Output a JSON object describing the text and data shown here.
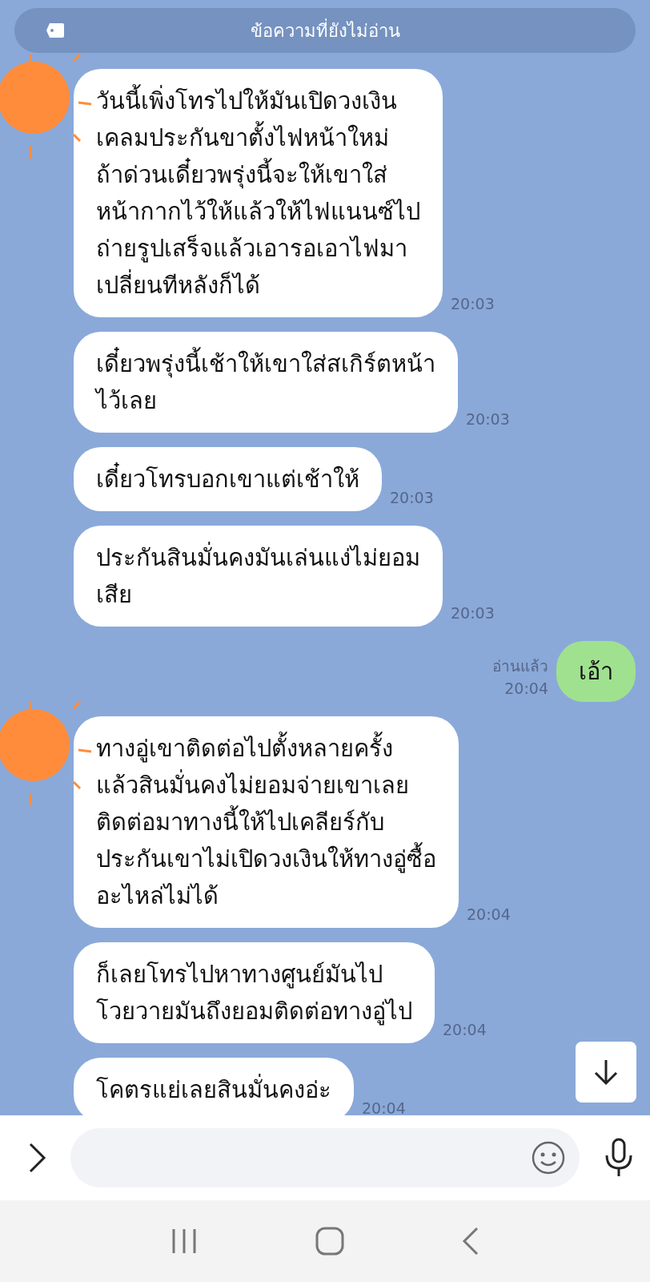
{
  "banner": {
    "label": "ข้อความที่ยังไม่อ่าน"
  },
  "messages": [
    {
      "kind": "received",
      "avatar": true,
      "text": "วันนี้เพิ่งโทรไปให้มันเปิดวงเงิน\nเคลมประกันขาตั้งไฟหน้าใหม่\nถ้าด่วนเดี๋ยวพรุ่งนี้จะให้เขาใส่\nหน้ากากไว้ให้แล้วให้ไฟแนนซ์ไป\nถ่ายรูปเสร็จแล้วเอารอเอาไฟมา\nเปลี่ยนทีหลังก็ได้",
      "time": "20:03"
    },
    {
      "kind": "received",
      "avatar": false,
      "text": "เดี๋ยวพรุ่งนี้เช้าให้เขาใส่สเกิร์ตหน้า\nไว้เลย",
      "time": "20:03"
    },
    {
      "kind": "received",
      "avatar": false,
      "text": "เดี๋ยวโทรบอกเขาแต่เช้าให้",
      "time": "20:03"
    },
    {
      "kind": "received",
      "avatar": false,
      "text": "ประกันสินมั่นคงมันเล่นแง่ไม่ยอม\nเสีย",
      "time": "20:03"
    },
    {
      "kind": "sent",
      "text": "เอ้า",
      "status": "อ่านแล้ว",
      "time": "20:04"
    },
    {
      "kind": "received",
      "avatar": true,
      "text": "ทางอู่เขาติดต่อไปตั้งหลายครั้ง\nแล้วสินมั่นคงไม่ยอมจ่ายเขาเลย\nติดต่อมาทางนี้ให้ไปเคลียร์กับ\nประกันเขาไม่เปิดวงเงินให้ทางอู่ซื้อ\nอะไหล่ไม่ได้",
      "time": "20:04"
    },
    {
      "kind": "received",
      "avatar": false,
      "text": "ก็เลยโทรไปหาทางศูนย์มันไป\nโวยวายมันถึงยอมติดต่อทางอู่ไป",
      "time": "20:04"
    },
    {
      "kind": "received",
      "avatar": false,
      "text": "โคตรแย่เลยสินมั่นคงอ่ะ",
      "time": "20:04"
    }
  ]
}
